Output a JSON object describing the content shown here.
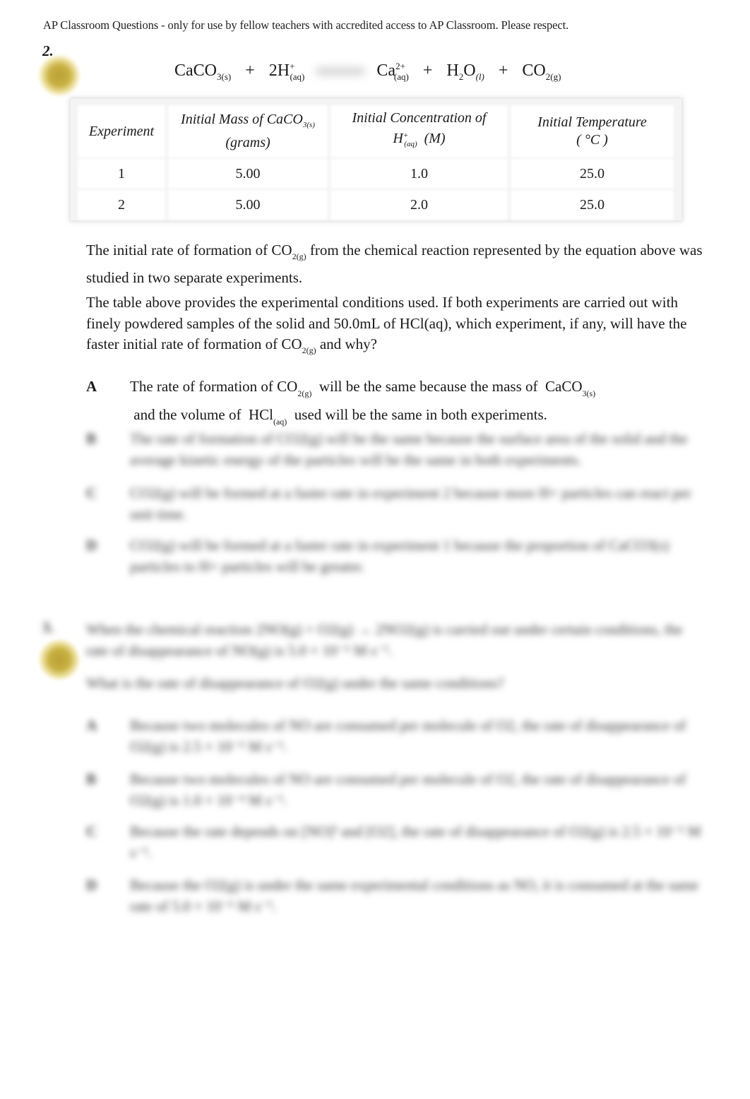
{
  "header_note": "AP Classroom Questions - only for use by fellow teachers with accredited access to AP Classroom. Please respect.",
  "question": {
    "number": "2.",
    "equation": {
      "reactant1": {
        "formula": "CaCO",
        "sub": "3(s)"
      },
      "plus1": "+",
      "reactant2": {
        "formula": "2H",
        "sup": "+",
        "sub": "(aq)"
      },
      "product1": {
        "formula": "Ca",
        "sup": "2+",
        "sub": "(aq)"
      },
      "plus2": "+",
      "product2": {
        "formula_a": "H",
        "sub_a": "2",
        "formula_b": "O",
        "sub_b": "(l)"
      },
      "plus3": "+",
      "product3": {
        "formula": "CO",
        "sub": "2(g)"
      }
    },
    "table": {
      "headers": [
        {
          "text": "Experiment"
        },
        {
          "text": "Initial Mass of CaCO",
          "sub": "3(s)",
          "line2": "(grams)"
        },
        {
          "text": "Initial Concentration of",
          "line2_a": "H",
          "line2_sup": "+",
          "line2_sub": "(aq)",
          "line2_b": "  (M)"
        },
        {
          "text": "Initial Temperature",
          "line2": "( °C )"
        }
      ],
      "rows": [
        [
          "1",
          "5.00",
          "1.0",
          "25.0"
        ],
        [
          "2",
          "5.00",
          "2.0",
          "25.0"
        ]
      ]
    },
    "paragraph1": {
      "a": "The initial rate of formation of CO",
      "sub": "2(g)",
      "b": " from the chemical reaction represented by the equation above was studied in two separate experiments."
    },
    "paragraph2": {
      "a": "The table above provides the experimental conditions used. If both experiments are carried out with finely powdered samples of the solid and 50.0mL of HCl(aq), which experiment, if any, will have the faster initial rate of formation of CO",
      "sub": "2(g)",
      "b": " and why?"
    },
    "options": [
      {
        "letter": "A",
        "a": "The rate of formation of CO",
        "sub1": "2(g)",
        "b": "  will be the same because the mass of  CaCO",
        "sub2": "3(s)",
        "c": " and the volume of  HCl",
        "sub3": "(aq)",
        "d": "  used will be the same in both experiments."
      },
      {
        "letter": "B",
        "text": "The rate of formation of CO2(g) will be the same because the surface area of the solid and the average kinetic energy of the particles will be the same in both experiments."
      },
      {
        "letter": "C",
        "text": "CO2(g) will be formed at a faster rate in experiment 2 because more H+ particles can react per unit time."
      },
      {
        "letter": "D",
        "text": "CO2(g) will be formed at a faster rate in experiment 1 because the proportion of CaCO3(s) particles to H+ particles will be greater."
      }
    ]
  },
  "next_question": {
    "number": "3.",
    "stem": "When the chemical reaction 2NO(g) + O2(g) → 2NO2(g) is carried out under certain conditions, the rate of disappearance of NO(g) is 5.0 × 10⁻⁵ M s⁻¹.",
    "ask": "What is the rate of disappearance of O2(g) under the same conditions?",
    "options": [
      {
        "letter": "A",
        "text": "Because two molecules of NO are consumed per molecule of O2, the rate of disappearance of O2(g) is 2.5 × 10⁻⁵ M s⁻¹."
      },
      {
        "letter": "B",
        "text": "Because two molecules of NO are consumed per molecule of O2, the rate of disappearance of O2(g) is 1.0 × 10⁻⁴ M s⁻¹."
      },
      {
        "letter": "C",
        "text": "Because the rate depends on [NO]² and [O2], the rate of disappearance of O2(g) is 2.5 × 10⁻⁵ M s⁻¹."
      },
      {
        "letter": "D",
        "text": "Because the O2(g) is under the same experimental conditions as NO, it is consumed at the same rate of 5.0 × 10⁻⁵ M s⁻¹."
      }
    ]
  }
}
